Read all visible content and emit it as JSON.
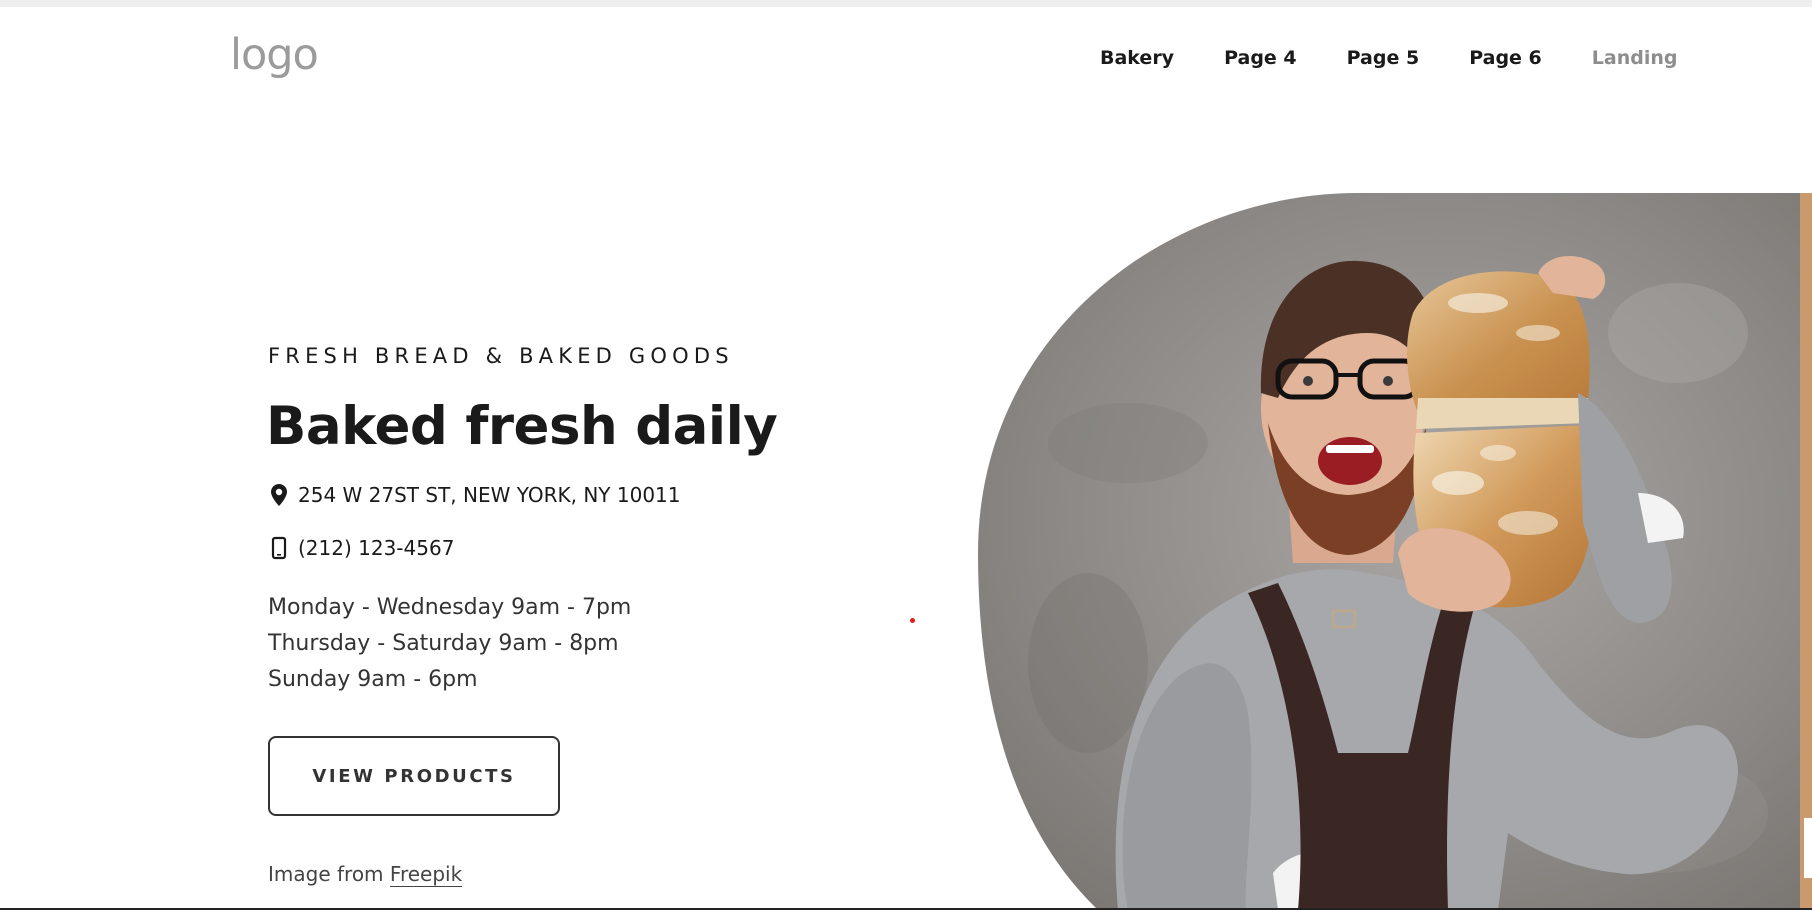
{
  "header": {
    "logo_text": "logo",
    "nav": [
      {
        "label": "Bakery"
      },
      {
        "label": "Page 4"
      },
      {
        "label": "Page 5"
      },
      {
        "label": "Page 6"
      },
      {
        "label": "Landing"
      }
    ]
  },
  "hero": {
    "eyebrow": "FRESH BREAD & BAKED GOODS",
    "headline": "Baked fresh daily",
    "address": "254 W 27ST ST, NEW YORK, NY 10011",
    "phone": "(212) 123-4567",
    "hours": [
      "Monday - Wednesday 9am - 7pm",
      "Thursday - Saturday 9am - 8pm",
      "Sunday 9am - 6pm"
    ],
    "cta_label": "VIEW PRODUCTS",
    "credit_prefix": "Image from ",
    "credit_link": "Freepik"
  },
  "icons": {
    "address": "map-pin-icon",
    "phone": "mobile-phone-icon"
  },
  "colors": {
    "text": "#1a1a1a",
    "nav_muted": "#8d8d8d",
    "logo": "#9b9b9b",
    "accent_dot": "#e01e1e",
    "background": "#ffffff"
  }
}
